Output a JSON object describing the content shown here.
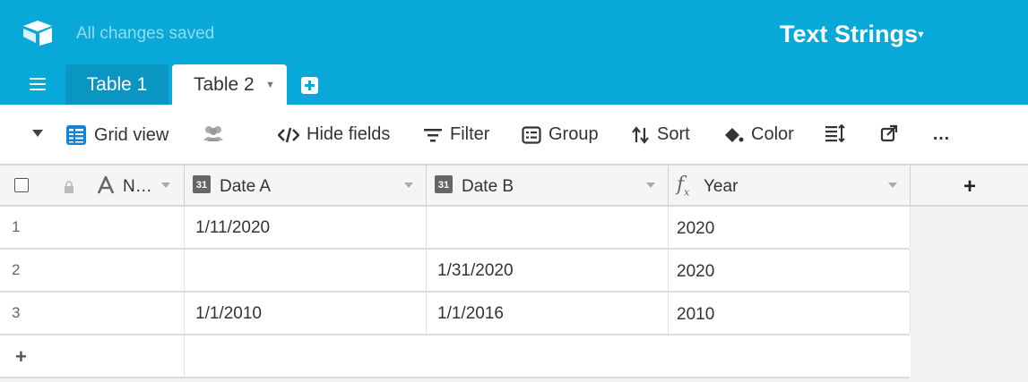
{
  "app": {
    "status": "All changes saved",
    "base_title": "Text Strings"
  },
  "tabs": [
    {
      "label": "Table 1"
    },
    {
      "label": "Table 2"
    }
  ],
  "toolbar": {
    "view_name": "Grid view",
    "hide_fields": "Hide fields",
    "filter": "Filter",
    "group": "Group",
    "sort": "Sort",
    "color": "Color",
    "more": "…"
  },
  "columns": [
    {
      "name": "N…",
      "icon": "text-icon"
    },
    {
      "name": "Date A",
      "icon": "calendar-icon",
      "icon_text": "31"
    },
    {
      "name": "Date B",
      "icon": "calendar-icon",
      "icon_text": "31"
    },
    {
      "name": "Year",
      "icon": "formula-icon"
    }
  ],
  "rows": [
    {
      "num": "1",
      "date_a": "1/11/2020",
      "date_b": "",
      "year": "2020"
    },
    {
      "num": "2",
      "date_a": "",
      "date_b": "1/31/2020",
      "year": "2020"
    },
    {
      "num": "3",
      "date_a": "1/1/2010",
      "date_b": "1/1/2016",
      "year": "2010"
    }
  ],
  "add_row_label": "+",
  "add_column_label": "+",
  "colors": {
    "brand": "#08a8d8",
    "active_tab": "#0996c2"
  }
}
